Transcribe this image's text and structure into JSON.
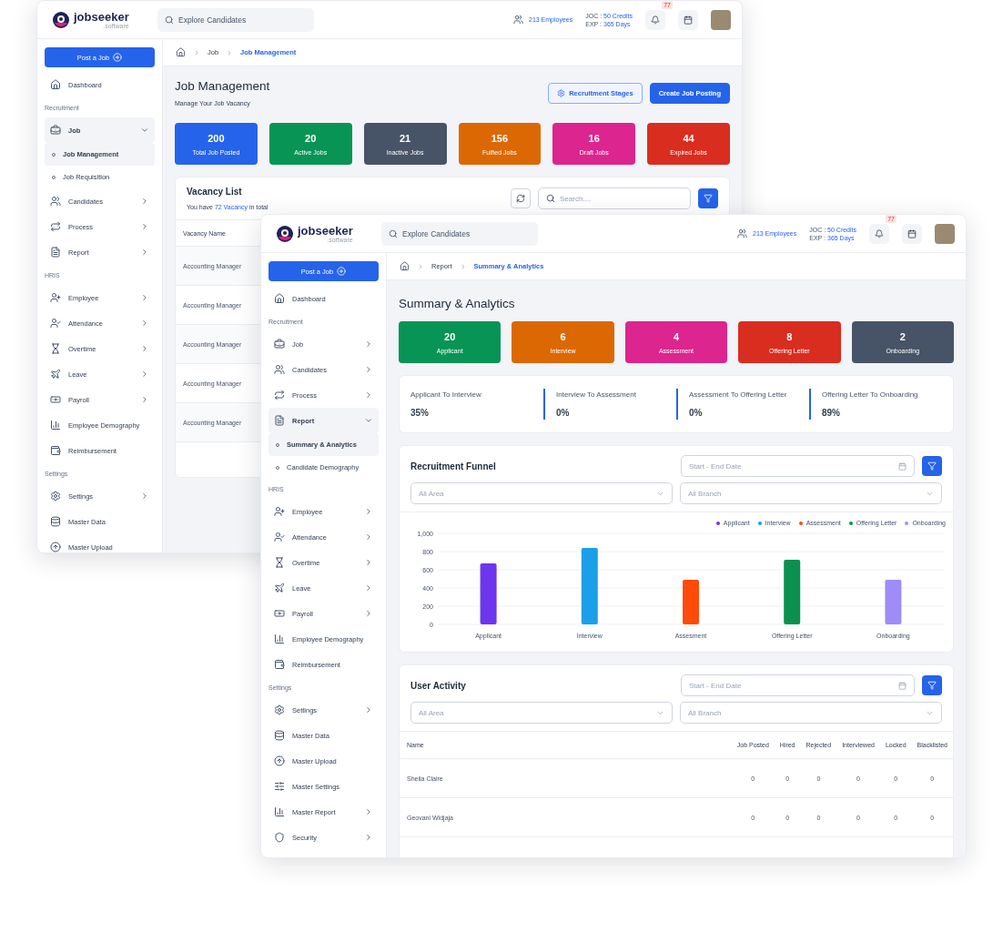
{
  "back_window": {
    "header": {
      "logo": {
        "name": "jobseeker",
        "suffix": ".software"
      },
      "search": {
        "placeholder": "Explore Candidates"
      },
      "employees": "213 Employees",
      "credits": {
        "label": "JOC :",
        "value": "50 Credits"
      },
      "expiry": {
        "label": "EXP :",
        "value": "365 Days"
      },
      "notifications": "77"
    },
    "post_button": "Post a Job",
    "sidebar": [
      {
        "kind": "item",
        "label": "Dashboard",
        "expandable": false,
        "expanded": false
      },
      {
        "kind": "section",
        "label": "Recruitment"
      },
      {
        "kind": "item",
        "label": "Job",
        "expandable": true,
        "expanded": true,
        "children": [
          {
            "label": "Job Management",
            "selected": true
          },
          {
            "label": "Job Requisition",
            "selected": false
          }
        ]
      },
      {
        "kind": "item",
        "label": "Candidates",
        "expandable": true,
        "expanded": false
      },
      {
        "kind": "item",
        "label": "Process",
        "expandable": true,
        "expanded": false
      },
      {
        "kind": "item",
        "label": "Report",
        "expandable": true,
        "expanded": false
      },
      {
        "kind": "section",
        "label": "HRIS"
      },
      {
        "kind": "item",
        "label": "Employee",
        "expandable": true,
        "expanded": false
      },
      {
        "kind": "item",
        "label": "Attendance",
        "expandable": true,
        "expanded": false
      },
      {
        "kind": "item",
        "label": "Overtime",
        "expandable": true,
        "expanded": false
      },
      {
        "kind": "item",
        "label": "Leave",
        "expandable": true,
        "expanded": false
      },
      {
        "kind": "item",
        "label": "Payroll",
        "expandable": true,
        "expanded": false
      },
      {
        "kind": "item",
        "label": "Employee Demography",
        "expandable": false,
        "expanded": false
      },
      {
        "kind": "item",
        "label": "Reimbursement",
        "expandable": false,
        "expanded": false
      },
      {
        "kind": "section",
        "label": "Settings"
      },
      {
        "kind": "item",
        "label": "Settings",
        "expandable": true,
        "expanded": false
      },
      {
        "kind": "item",
        "label": "Master Data",
        "expandable": false,
        "expanded": false
      },
      {
        "kind": "item",
        "label": "Master Upload",
        "expandable": false,
        "expanded": false
      }
    ],
    "breadcrumb": [
      {
        "label": "Job",
        "selected": false
      },
      {
        "label": "Job Management",
        "selected": true
      }
    ],
    "page": {
      "title": "Job Management",
      "subtitle": "Manage Your Job Vacancy",
      "actions": [
        {
          "label": "Recruitment Stages",
          "kind": "outline"
        },
        {
          "label": "Create Job Posting",
          "kind": "primary"
        }
      ],
      "stats": [
        {
          "value": "200",
          "label": "Total Job Posted",
          "color": "#2563eb"
        },
        {
          "value": "20",
          "label": "Active Jobs",
          "color": "#079455"
        },
        {
          "value": "21",
          "label": "Inactive Jobs",
          "color": "#475467"
        },
        {
          "value": "156",
          "label": "Fulfied Jobs",
          "color": "#dc6803"
        },
        {
          "value": "16",
          "label": "Draft Jobs",
          "color": "#dd2590"
        },
        {
          "value": "44",
          "label": "Expired Jobs",
          "color": "#d92d20"
        }
      ],
      "vacancy": {
        "title": "Vacancy List",
        "summary": {
          "before": "You have",
          "link": "72 Vacancy",
          "after": "in total"
        },
        "search": {
          "placeholder": "Search...."
        },
        "columns": [
          "Vacancy Name"
        ],
        "rows": [
          "Accounting Manager",
          "Accounting Manager",
          "Accounting Manager",
          "Accounting Manager",
          "Accounting Manager"
        ]
      }
    }
  },
  "front_window": {
    "header": {
      "logo": {
        "name": "jobseeker",
        "suffix": ".software"
      },
      "search": {
        "placeholder": "Explore Candidates"
      },
      "employees": "213 Employees",
      "credits": {
        "label": "JOC :",
        "value": "50 Credits"
      },
      "expiry": {
        "label": "EXP :",
        "value": "365 Days"
      },
      "notifications": "77"
    },
    "post_button": "Post a Job",
    "sidebar": [
      {
        "kind": "item",
        "label": "Dashboard",
        "expandable": false,
        "expanded": false
      },
      {
        "kind": "section",
        "label": "Recruitment"
      },
      {
        "kind": "item",
        "label": "Job",
        "expandable": true,
        "expanded": false
      },
      {
        "kind": "item",
        "label": "Candidates",
        "expandable": true,
        "expanded": false
      },
      {
        "kind": "item",
        "label": "Process",
        "expandable": true,
        "expanded": false
      },
      {
        "kind": "item",
        "label": "Report",
        "expandable": true,
        "expanded": true,
        "children": [
          {
            "label": "Summary & Analytics",
            "selected": true
          },
          {
            "label": "Candidate Demography",
            "selected": false
          }
        ]
      },
      {
        "kind": "section",
        "label": "HRIS"
      },
      {
        "kind": "item",
        "label": "Employee",
        "expandable": true,
        "expanded": false
      },
      {
        "kind": "item",
        "label": "Attendance",
        "expandable": true,
        "expanded": false
      },
      {
        "kind": "item",
        "label": "Overtime",
        "expandable": true,
        "expanded": false
      },
      {
        "kind": "item",
        "label": "Leave",
        "expandable": true,
        "expanded": false
      },
      {
        "kind": "item",
        "label": "Payroll",
        "expandable": true,
        "expanded": false
      },
      {
        "kind": "item",
        "label": "Employee Demography",
        "expandable": false,
        "expanded": false
      },
      {
        "kind": "item",
        "label": "Reimbursement",
        "expandable": false,
        "expanded": false
      },
      {
        "kind": "section",
        "label": "Settings"
      },
      {
        "kind": "item",
        "label": "Settings",
        "expandable": true,
        "expanded": false
      },
      {
        "kind": "item",
        "label": "Master Data",
        "expandable": false,
        "expanded": false
      },
      {
        "kind": "item",
        "label": "Master Upload",
        "expandable": false,
        "expanded": false
      },
      {
        "kind": "item",
        "label": "Master Settings",
        "expandable": false,
        "expanded": false
      },
      {
        "kind": "item",
        "label": "Master Report",
        "expandable": true,
        "expanded": false
      },
      {
        "kind": "item",
        "label": "Security",
        "expandable": true,
        "expanded": false
      }
    ],
    "breadcrumb": [
      {
        "label": "Report",
        "selected": false
      },
      {
        "label": "Summary & Analytics",
        "selected": true
      }
    ],
    "page": {
      "title": "Summary & Analytics",
      "stats": [
        {
          "value": "20",
          "label": "Applicant",
          "color": "#079455"
        },
        {
          "value": "6",
          "label": "Interview",
          "color": "#dc6803"
        },
        {
          "value": "4",
          "label": "Assessment",
          "color": "#dd2590"
        },
        {
          "value": "8",
          "label": "Offering Letter",
          "color": "#d92d20"
        },
        {
          "value": "2",
          "label": "Onboarding",
          "color": "#475467"
        }
      ],
      "conversions": [
        {
          "label": "Applicant To Interview",
          "value": "35%"
        },
        {
          "label": "Interview To Assessment",
          "value": "0%"
        },
        {
          "label": "Assessment To Offering Letter",
          "value": "0%"
        },
        {
          "label": "Offering Letter To Onboarding",
          "value": "89%"
        }
      ],
      "funnel": {
        "title": "Recruitment Funnel",
        "date": {
          "placeholder": "Start - End Date"
        },
        "area": {
          "placeholder": "All Area"
        },
        "branch": {
          "placeholder": "All Branch"
        },
        "chart_data": {
          "type": "bar",
          "categories": [
            "Applicant",
            "Interview",
            "Assesment",
            "Offering Letter",
            "Onboarding"
          ],
          "series": [
            {
              "name": "Applicant",
              "color": "#6d35ee",
              "values": [
                670,
                null,
                null,
                null,
                null
              ]
            },
            {
              "name": "Interview",
              "color": "#1a9fe8",
              "values": [
                null,
                840,
                null,
                null,
                null
              ]
            },
            {
              "name": "Assessment",
              "color": "#ff4a0a",
              "values": [
                null,
                null,
                490,
                null,
                null
              ]
            },
            {
              "name": "Offering Letter",
              "color": "#0a9150",
              "values": [
                null,
                null,
                null,
                710,
                null
              ]
            },
            {
              "name": "Onboarding",
              "color": "#a08cf8",
              "values": [
                null,
                null,
                null,
                null,
                490
              ]
            }
          ],
          "ylim": [
            0,
            1000
          ],
          "grid": true,
          "legend": true,
          "yticks": [
            {
              "value": 0,
              "label": "0"
            },
            {
              "value": 200,
              "label": "200"
            },
            {
              "value": 400,
              "label": "400"
            },
            {
              "value": 600,
              "label": "600"
            },
            {
              "value": 800,
              "label": "800"
            },
            {
              "value": 1000,
              "label": "1,000"
            }
          ]
        }
      },
      "activity": {
        "title": "User Activity",
        "date": {
          "placeholder": "Start - End Date"
        },
        "area": {
          "placeholder": "All Area"
        },
        "branch": {
          "placeholder": "All Branch"
        },
        "columns": [
          "Name",
          "Job Posted",
          "Hired",
          "Rejected",
          "Interviewed",
          "Locked",
          "Blacklisted"
        ],
        "rows": [
          [
            "Sheila Claire",
            "0",
            "0",
            "0",
            "0",
            "0",
            "0"
          ],
          [
            "Geovani Widjaja",
            "0",
            "0",
            "0",
            "0",
            "0",
            "0"
          ]
        ]
      }
    }
  }
}
